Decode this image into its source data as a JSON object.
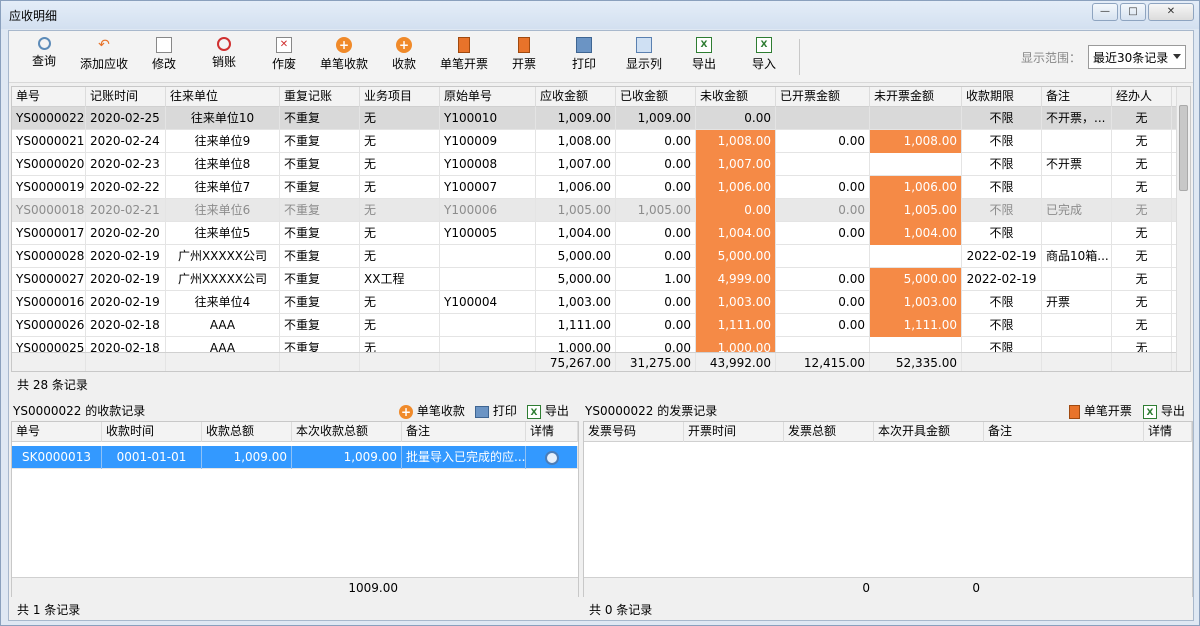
{
  "window": {
    "title": "应收明细",
    "btn_min": "—",
    "btn_max": "□",
    "btn_close": "✕"
  },
  "toolbar": {
    "buttons": [
      {
        "label": "查询",
        "icon": "search-icon"
      },
      {
        "label": "添加应收",
        "icon": "undo-icon"
      },
      {
        "label": "修改",
        "icon": "edit-icon"
      },
      {
        "label": "销账",
        "icon": "cancel-icon"
      },
      {
        "label": "作废",
        "icon": "void-icon"
      },
      {
        "label": "单笔收款",
        "icon": "add-circle-icon"
      },
      {
        "label": "收款",
        "icon": "add-circle-icon"
      },
      {
        "label": "单笔开票",
        "icon": "invoice-icon"
      },
      {
        "label": "开票",
        "icon": "invoice-icon"
      },
      {
        "label": "打印",
        "icon": "print-icon"
      },
      {
        "label": "显示列",
        "icon": "columns-icon"
      },
      {
        "label": "导出",
        "icon": "excel-icon"
      },
      {
        "label": "导入",
        "icon": "excel-icon"
      }
    ],
    "range_label": "显示范围：",
    "range_value": "最近30条记录"
  },
  "grid": {
    "headers": [
      "单号",
      "记账时间",
      "往来单位",
      "重复记账",
      "业务项目",
      "原始单号",
      "应收金额",
      "已收金额",
      "未收金额",
      "已开票金额",
      "未开票金额",
      "收款期限",
      "备注",
      "经办人"
    ],
    "rows": [
      [
        "YS0000022",
        "2020-02-25",
        "往来单位10",
        "不重复",
        "无",
        "Y100010",
        "1,009.00",
        "1,009.00",
        "0.00",
        "",
        "",
        "不限",
        "不开票，...",
        "无"
      ],
      [
        "YS0000021",
        "2020-02-24",
        "往来单位9",
        "不重复",
        "无",
        "Y100009",
        "1,008.00",
        "0.00",
        "1,008.00",
        "0.00",
        "1,008.00",
        "不限",
        "",
        "无"
      ],
      [
        "YS0000020",
        "2020-02-23",
        "往来单位8",
        "不重复",
        "无",
        "Y100008",
        "1,007.00",
        "0.00",
        "1,007.00",
        "",
        "",
        "不限",
        "不开票",
        "无"
      ],
      [
        "YS0000019",
        "2020-02-22",
        "往来单位7",
        "不重复",
        "无",
        "Y100007",
        "1,006.00",
        "0.00",
        "1,006.00",
        "0.00",
        "1,006.00",
        "不限",
        "",
        "无"
      ],
      [
        "YS0000018",
        "2020-02-21",
        "往来单位6",
        "不重复",
        "无",
        "Y100006",
        "1,005.00",
        "1,005.00",
        "0.00",
        "0.00",
        "1,005.00",
        "不限",
        "已完成",
        "无"
      ],
      [
        "YS0000017",
        "2020-02-20",
        "往来单位5",
        "不重复",
        "无",
        "Y100005",
        "1,004.00",
        "0.00",
        "1,004.00",
        "0.00",
        "1,004.00",
        "不限",
        "",
        "无"
      ],
      [
        "YS0000028",
        "2020-02-19",
        "广州XXXXX公司",
        "不重复",
        "无",
        "",
        "5,000.00",
        "0.00",
        "5,000.00",
        "",
        "",
        "2022-02-19",
        "商品10箱...",
        "无"
      ],
      [
        "YS0000027",
        "2020-02-19",
        "广州XXXXX公司",
        "不重复",
        "XX工程",
        "",
        "5,000.00",
        "1.00",
        "4,999.00",
        "0.00",
        "5,000.00",
        "2022-02-19",
        "",
        "无"
      ],
      [
        "YS0000016",
        "2020-02-19",
        "往来单位4",
        "不重复",
        "无",
        "Y100004",
        "1,003.00",
        "0.00",
        "1,003.00",
        "0.00",
        "1,003.00",
        "不限",
        "开票",
        "无"
      ],
      [
        "YS0000026",
        "2020-02-18",
        "AAA",
        "不重复",
        "无",
        "",
        "1,111.00",
        "0.00",
        "1,111.00",
        "0.00",
        "1,111.00",
        "不限",
        "",
        "无"
      ],
      [
        "YS0000025",
        "2020-02-18",
        "AAA",
        "不重复",
        "无",
        "",
        "1,000.00",
        "0.00",
        "1,000.00",
        "",
        "",
        "不限",
        "",
        "无"
      ]
    ],
    "totals": {
      "receivable": "75,267.00",
      "received": "31,275.00",
      "unreceived": "43,992.00",
      "invoiced": "12,415.00",
      "uninvoiced": "52,335.00"
    },
    "count_text": "共 28 条记录"
  },
  "receipts": {
    "title": "YS0000022 的收款记录",
    "actions": {
      "single": "单笔收款",
      "print": "打印",
      "export": "导出"
    },
    "headers": [
      "单号",
      "收款时间",
      "收款总额",
      "本次收款总额",
      "备注",
      "详情"
    ],
    "row": [
      "SK0000013",
      "0001-01-01",
      "1,009.00",
      "1,009.00",
      "批量导入已完成的应..."
    ],
    "total": "1009.00",
    "count_text": "共 1 条记录"
  },
  "invoices": {
    "title": "YS0000022 的发票记录",
    "actions": {
      "single": "单笔开票",
      "export": "导出"
    },
    "headers": [
      "发票号码",
      "开票时间",
      "发票总额",
      "本次开具金额",
      "备注",
      "详情"
    ],
    "total1": "0",
    "total2": "0",
    "count_text": "共 0 条记录"
  },
  "colors": {
    "orange": "#f58a46",
    "selected_row": "#3399ff"
  }
}
